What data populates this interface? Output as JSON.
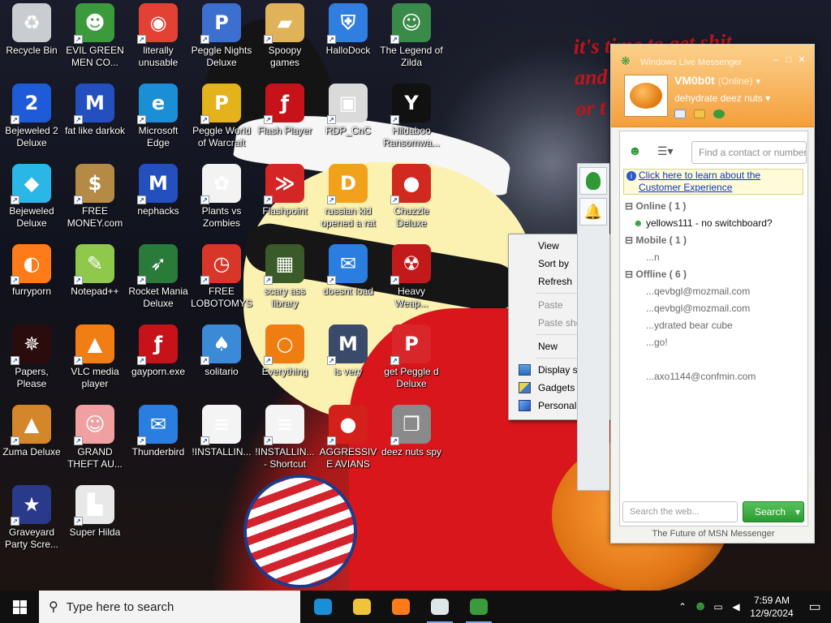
{
  "wallpaper": {
    "slogan": "it's time to get shit\nand\nor t"
  },
  "desktop_icons": [
    {
      "label": "Recycle Bin",
      "icon": "recycle-bin-icon",
      "color": "#c9cdd2",
      "glyph": "♻"
    },
    {
      "label": "EVIL GREEN MEN CO...",
      "icon": "msn-buddies-icon",
      "color": "#3a9a3c",
      "glyph": "☻"
    },
    {
      "label": "literally unusable",
      "icon": "chrome-icon",
      "color": "#e34133",
      "glyph": "◉"
    },
    {
      "label": "Peggle Nights Deluxe",
      "icon": "peggle-icon",
      "color": "#3d6fd1",
      "glyph": "P"
    },
    {
      "label": "Spoopy games",
      "icon": "folder-icon",
      "color": "#e0b35a",
      "glyph": "▰"
    },
    {
      "label": "HalloDock",
      "icon": "windows-shield-icon",
      "color": "#2f7ee0",
      "glyph": "⛨"
    },
    {
      "label": "The Legend of Zilda",
      "icon": "zelda-icon",
      "color": "#3a8a4a",
      "glyph": "☺"
    },
    {
      "label": "Bejeweled 2 Deluxe",
      "icon": "bejeweled-icon",
      "color": "#1e5bd8",
      "glyph": "2"
    },
    {
      "label": "fat like darkok",
      "icon": "mpl-icon",
      "color": "#234fbf",
      "glyph": "M"
    },
    {
      "label": "Microsoft Edge",
      "icon": "edge-icon",
      "color": "#1b8fd6",
      "glyph": "e"
    },
    {
      "label": "Peggle World of Warcraft",
      "icon": "peggle-icon",
      "color": "#e4b21a",
      "glyph": "P"
    },
    {
      "label": "Flash Player",
      "icon": "flash-icon",
      "color": "#c8121a",
      "glyph": "ƒ"
    },
    {
      "label": "RDP_CnC",
      "icon": "rdp-icon",
      "color": "#dadada",
      "glyph": "▣"
    },
    {
      "label": "Hildaboo Ransomwa...",
      "icon": "yashma-icon",
      "color": "#111111",
      "glyph": "Y"
    },
    {
      "label": "Bejeweled Deluxe",
      "icon": "gem-icon",
      "color": "#2bb6e8",
      "glyph": "◆"
    },
    {
      "label": "FREE MONEY.com",
      "icon": "money-bag-icon",
      "color": "#b58a45",
      "glyph": "$"
    },
    {
      "label": "nephacks",
      "icon": "mpi-icon",
      "color": "#234fbf",
      "glyph": "M"
    },
    {
      "label": "Plants vs Zombies",
      "icon": "flower-icon",
      "color": "#f3f3f3",
      "glyph": "✿"
    },
    {
      "label": "Flashpoint",
      "icon": "flashpoint-icon",
      "color": "#d52626",
      "glyph": "≫"
    },
    {
      "label": "russian kid opened a rat",
      "icon": "de-icon",
      "color": "#f2a11a",
      "glyph": "D"
    },
    {
      "label": "Chuzzle Deluxe",
      "icon": "chuzzle-icon",
      "color": "#d1291f",
      "glyph": "●"
    },
    {
      "label": "furryporn",
      "icon": "firefox-icon",
      "color": "#ff7b1a",
      "glyph": "◐"
    },
    {
      "label": "Notepad++",
      "icon": "notepadpp-icon",
      "color": "#8fc84a",
      "glyph": "✎"
    },
    {
      "label": "Rocket Mania Deluxe",
      "icon": "rocket-icon",
      "color": "#2a7a3a",
      "glyph": "➶"
    },
    {
      "label": "FREE LOBOTOMYS",
      "icon": "stopwatch-icon",
      "color": "#d9362a",
      "glyph": "◷"
    },
    {
      "label": "scary ass library",
      "icon": "library-icon",
      "color": "#3a5a2a",
      "glyph": "▦"
    },
    {
      "label": "doesnt load",
      "icon": "thunderbird-icon",
      "color": "#2a7ee0",
      "glyph": "✉"
    },
    {
      "label": "Heavy Weap...",
      "icon": "radiation-icon",
      "color": "#c21a1a",
      "glyph": "☢"
    },
    {
      "label": "Papers, Please",
      "icon": "papers-please-icon",
      "color": "#2a0c0c",
      "glyph": "✵"
    },
    {
      "label": "VLC media player",
      "icon": "vlc-icon",
      "color": "#f07e15",
      "glyph": "▲"
    },
    {
      "label": "gayporn.exe",
      "icon": "flash-icon",
      "color": "#c8121a",
      "glyph": "ƒ"
    },
    {
      "label": "solitario",
      "icon": "cards-icon",
      "color": "#3a8ad8",
      "glyph": "♠"
    },
    {
      "label": "Everything",
      "icon": "search-ring-icon",
      "color": "#ef7d12",
      "glyph": "○"
    },
    {
      "label": "is very",
      "icon": "mpl-shield-icon",
      "color": "#3a4a6a",
      "glyph": "M"
    },
    {
      "label": "get Peggle d Deluxe",
      "icon": "peggle-icon",
      "color": "#d8262a",
      "glyph": "P"
    },
    {
      "label": "Zuma Deluxe",
      "icon": "zuma-icon",
      "color": "#d4862a",
      "glyph": "▲"
    },
    {
      "label": "GRAND THEFT AU...",
      "icon": "anime-girl-icon",
      "color": "#f0a0a0",
      "glyph": "☺"
    },
    {
      "label": "Thunderbird",
      "icon": "thunderbird-icon",
      "color": "#2a7ee0",
      "glyph": "✉"
    },
    {
      "label": "!INSTALLIN...",
      "icon": "document-icon",
      "color": "#f4f4f4",
      "glyph": "≡"
    },
    {
      "label": "!INSTALLIN... - Shortcut",
      "icon": "document-icon",
      "color": "#f4f4f4",
      "glyph": "≡"
    },
    {
      "label": "AGGRESSIVE AVIANS",
      "icon": "angry-bird-icon",
      "color": "#d4201a",
      "glyph": "●"
    },
    {
      "label": "deez nuts spy",
      "icon": "windows-stack-icon",
      "color": "#8a8a8a",
      "glyph": "❐"
    },
    {
      "label": "Graveyard Party Scre...",
      "icon": "voted-sticker-icon",
      "color": "#2a3a8a",
      "glyph": "★"
    },
    {
      "label": "Super Hilda",
      "icon": "pixel-dog-icon",
      "color": "#e8e8e8",
      "glyph": "▙"
    }
  ],
  "context_menu": {
    "view": "View",
    "sort_by": "Sort by",
    "refresh": "Refresh",
    "paste": "Paste",
    "paste_shortcut": "Paste shortcut",
    "new": "New",
    "display_settings": "Display settings",
    "gadgets": "Gadgets",
    "personalize": "Personalize"
  },
  "msn": {
    "title": "Windows Live Messenger",
    "display_name": "VM0b0t",
    "status": "(Online)",
    "personal_message": "dehydrate deez nuts",
    "find_contact_placeholder": "Find a contact or number...",
    "banner_link": "Click here to learn about the Customer Experience",
    "groups": [
      {
        "header": "Online ( 1 )",
        "contacts": [
          {
            "name": "yellows111 - no switchboard?",
            "online": true
          }
        ]
      },
      {
        "header": "Mobile ( 1 )",
        "contacts": [
          {
            "name": "...n",
            "online": false
          }
        ]
      },
      {
        "header": "Offline ( 6 )",
        "contacts": [
          {
            "name": "...qevbgl@mozmail.com",
            "online": false
          },
          {
            "name": "...qevbgl@mozmail.com",
            "online": false
          },
          {
            "name": "...ydrated bear cube",
            "online": false
          },
          {
            "name": "...go!",
            "online": false
          },
          {
            "name": "",
            "online": false
          },
          {
            "name": "...axo1144@confmin.com",
            "online": false
          }
        ]
      }
    ],
    "web_search_placeholder": "Search the web...",
    "search_button": "Search",
    "footer": "The Future of MSN Messenger",
    "accent_color": "#f59f3c"
  },
  "taskbar": {
    "search_placeholder": "Type here to search",
    "time": "7:59 AM",
    "date": "12/9/2024",
    "apps": [
      {
        "name": "edge-icon",
        "color": "#1b8fd6"
      },
      {
        "name": "file-explorer-icon",
        "color": "#f0c43a"
      },
      {
        "name": "firefox-icon",
        "color": "#ff7b1a"
      },
      {
        "name": "notepad-icon",
        "color": "#dfe6ea"
      },
      {
        "name": "msn-buddies-icon",
        "color": "#3a9a3c"
      }
    ]
  }
}
